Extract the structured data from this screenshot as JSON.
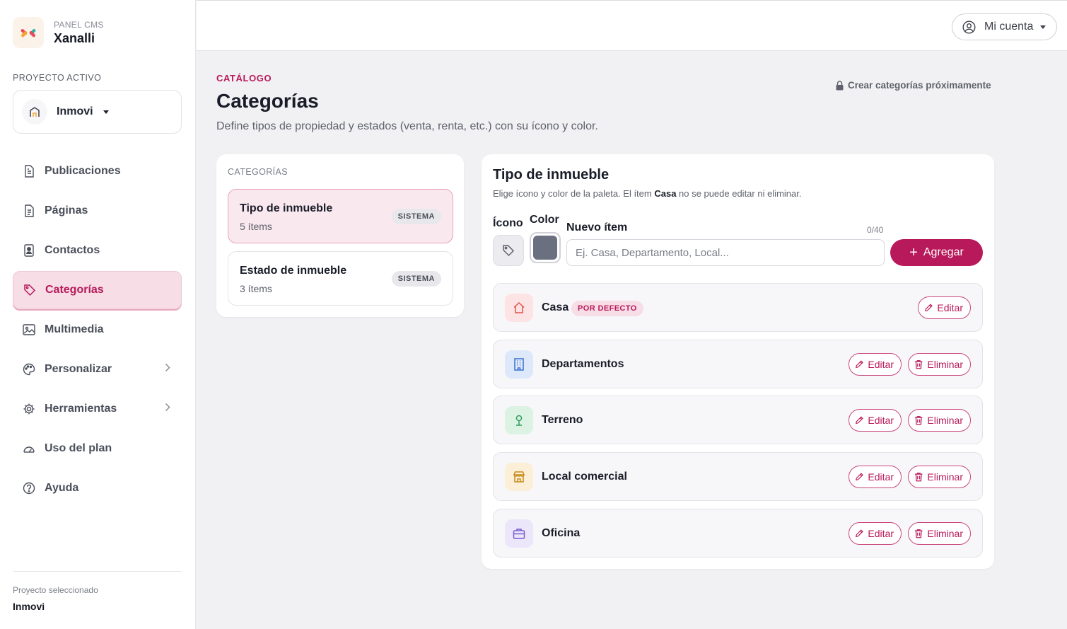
{
  "brand": {
    "small": "PANEL CMS",
    "name": "Xanalli"
  },
  "project": {
    "label": "PROYECTO ACTIVO",
    "name": "Inmovi"
  },
  "nav": [
    {
      "label": "Publicaciones",
      "icon": "document-icon"
    },
    {
      "label": "Páginas",
      "icon": "page-icon"
    },
    {
      "label": "Contactos",
      "icon": "contact-card-icon"
    },
    {
      "label": "Categorías",
      "icon": "tag-icon",
      "active": true
    },
    {
      "label": "Multimedia",
      "icon": "image-icon"
    },
    {
      "label": "Personalizar",
      "icon": "palette-icon",
      "chevron": true
    },
    {
      "label": "Herramientas",
      "icon": "gear-icon",
      "chevron": true
    },
    {
      "label": "Uso del plan",
      "icon": "gauge-icon"
    },
    {
      "label": "Ayuda",
      "icon": "help-icon"
    }
  ],
  "sidebar_footer": {
    "label": "Proyecto seleccionado",
    "value": "Inmovi"
  },
  "topbar": {
    "account_label": "Mi cuenta"
  },
  "header": {
    "eyebrow": "CATÁLOGO",
    "title": "Categorías",
    "subtitle": "Define tipos de propiedad y estados (venta, renta, etc.) con su ícono y color.",
    "coming_soon": "Crear categorías próximamente"
  },
  "categories": {
    "title": "CATEGORÍAS",
    "items": [
      {
        "name": "Tipo de inmueble",
        "count": "5 ítems",
        "badge": "SISTEMA",
        "selected": true
      },
      {
        "name": "Estado de inmueble",
        "count": "3 ítems",
        "badge": "SISTEMA",
        "selected": false
      }
    ]
  },
  "panel": {
    "title": "Tipo de inmueble",
    "hint_before": "Elige ícono y color de la paleta. El ítem ",
    "hint_bold": "Casa",
    "hint_after": " no se puede editar ni eliminar.",
    "icon_label": "Ícono",
    "color_label": "Color",
    "new_label": "Nuevo ítem",
    "counter": "0/40",
    "input_value": "",
    "input_placeholder": "Ej. Casa, Departamento, Local...",
    "selected_color": "#6b7080",
    "add_label": "Agregar",
    "edit_label": "Editar",
    "delete_label": "Eliminar",
    "items": [
      {
        "name": "Casa",
        "icon": "house-icon",
        "tint": "#fde4e4",
        "stroke": "#e0534f",
        "badge": "POR DEFECTO",
        "deletable": false
      },
      {
        "name": "Departamentos",
        "icon": "building-icon",
        "tint": "#dde9fb",
        "stroke": "#3b6fd0",
        "deletable": true
      },
      {
        "name": "Terreno",
        "icon": "map-pin-icon",
        "tint": "#dcf3e4",
        "stroke": "#2f9e5c",
        "deletable": true
      },
      {
        "name": "Local comercial",
        "icon": "store-icon",
        "tint": "#fcefd7",
        "stroke": "#c98a1c",
        "deletable": true
      },
      {
        "name": "Oficina",
        "icon": "briefcase-icon",
        "tint": "#ece6fb",
        "stroke": "#7b5ccf",
        "deletable": true
      }
    ]
  },
  "colors": {
    "accent": "#b8195a",
    "accent_soft": "#f6dde6"
  }
}
